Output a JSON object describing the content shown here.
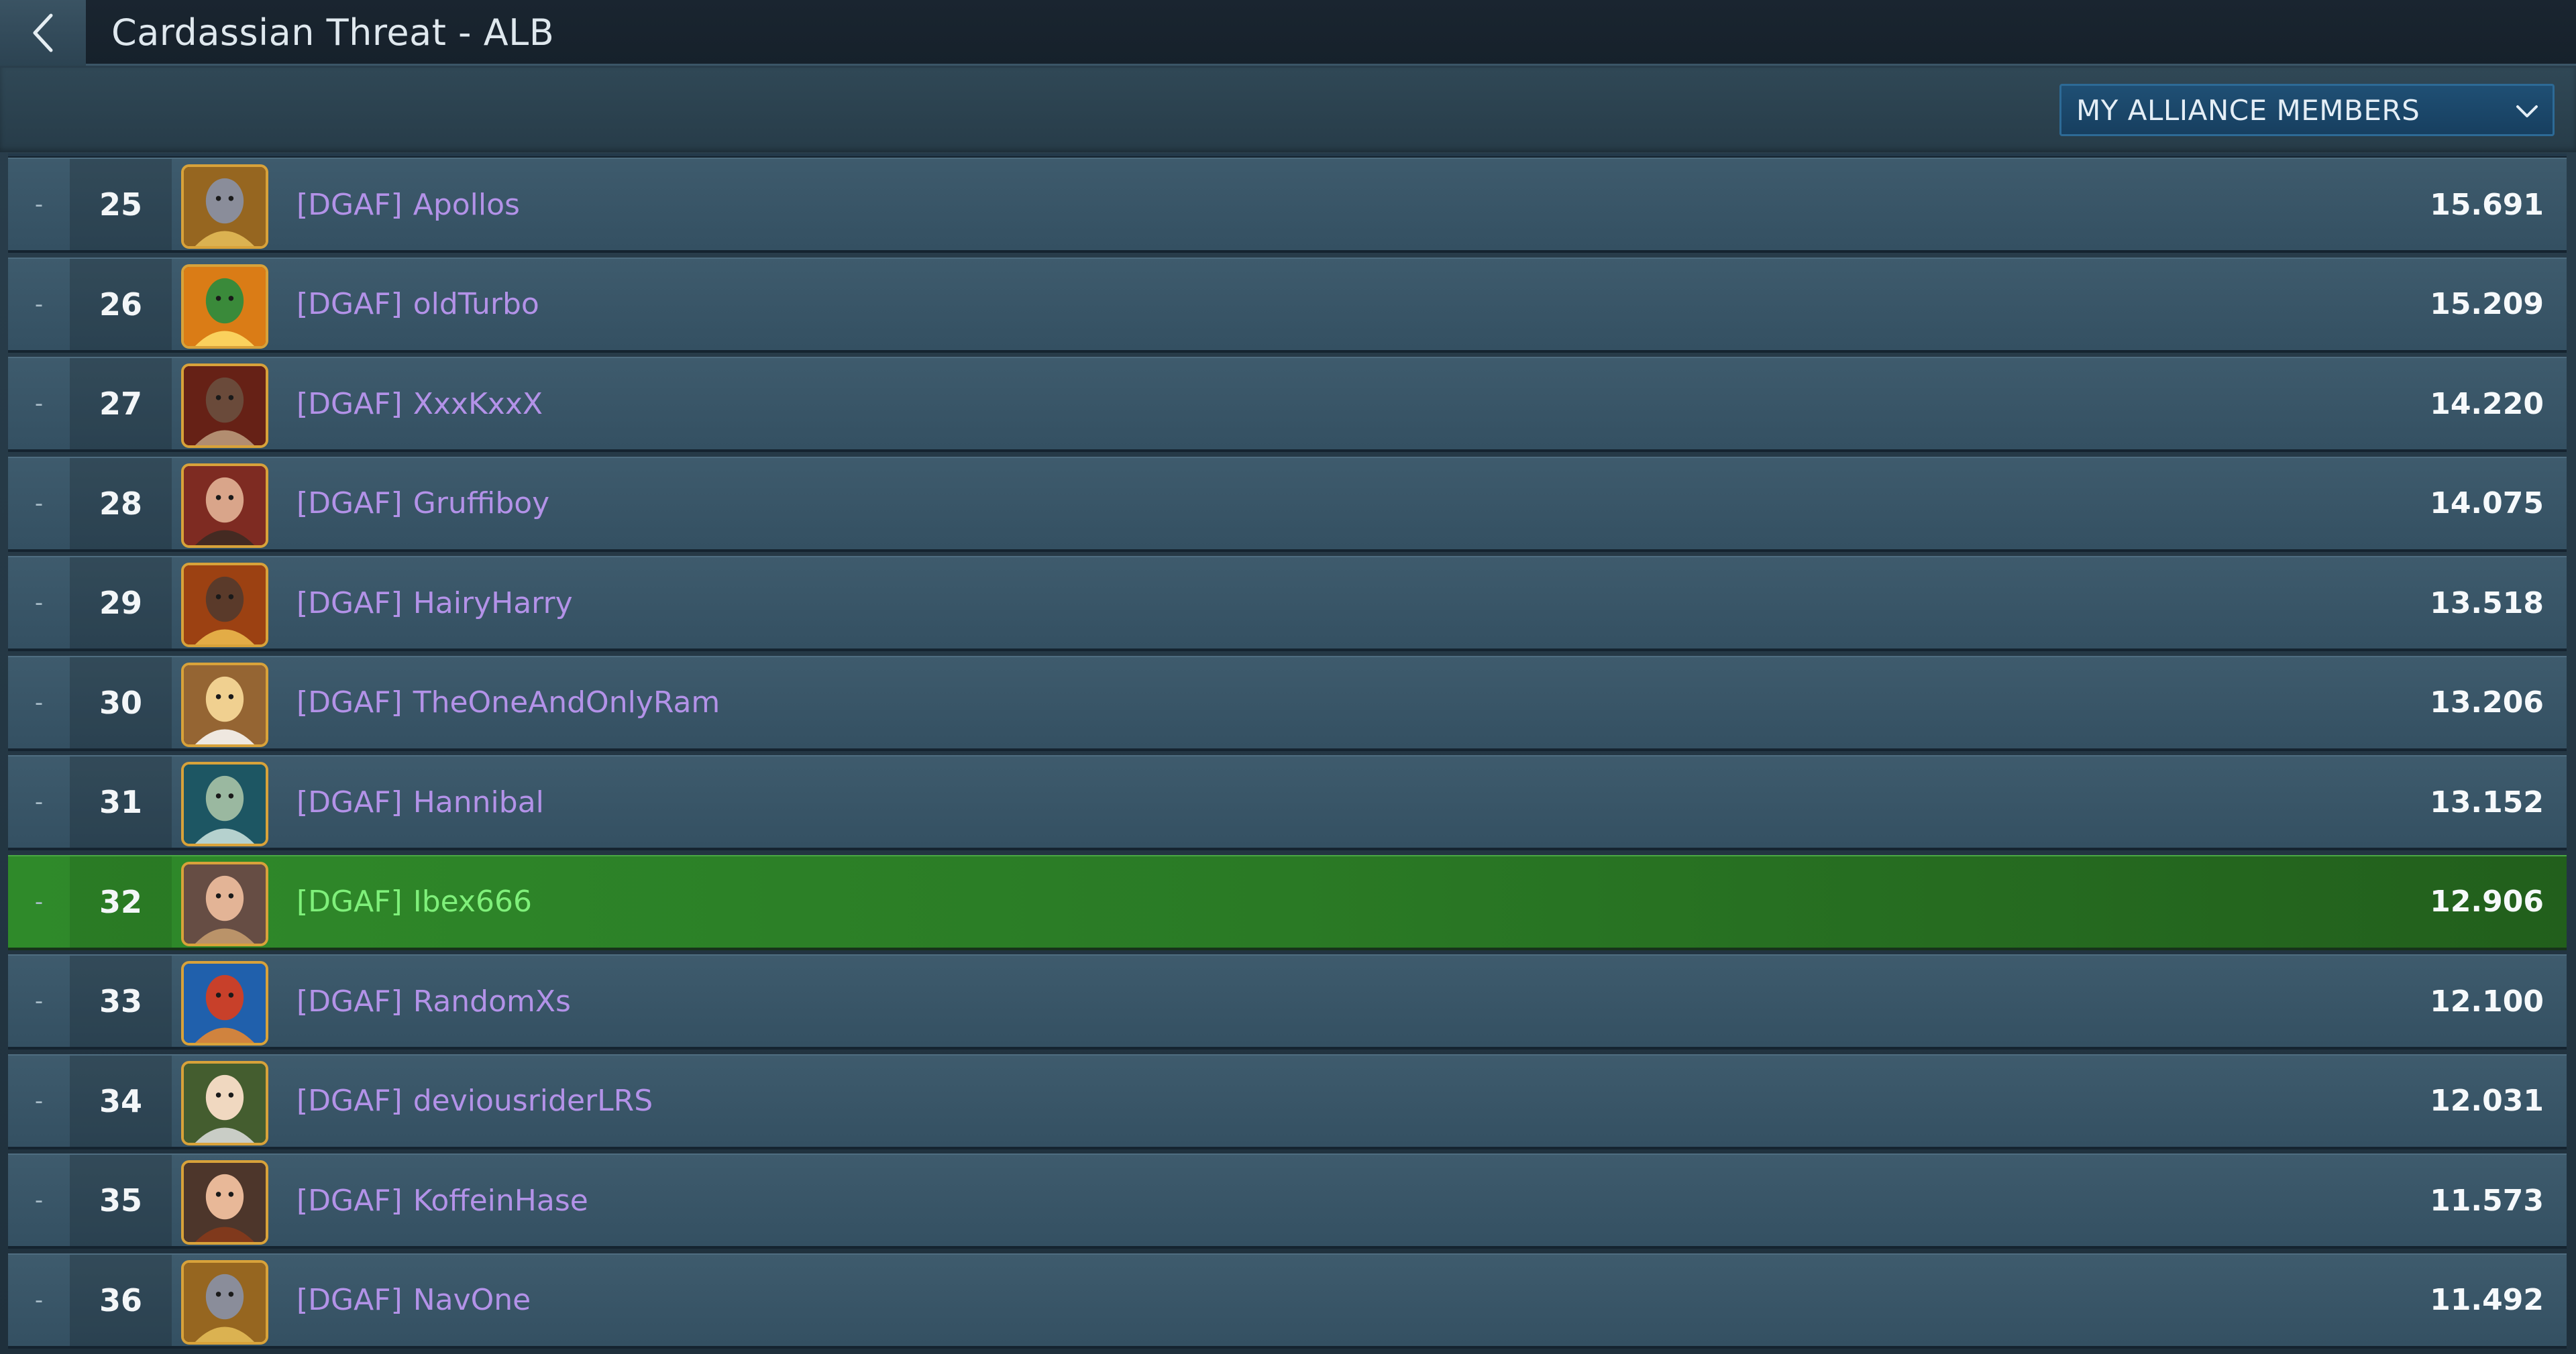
{
  "header": {
    "title": "Cardassian Threat - ALB",
    "back_icon": "chevron-left-icon"
  },
  "filter": {
    "selected": "MY ALLIANCE MEMBERS",
    "chevron_icon": "chevron-down-icon"
  },
  "colors": {
    "tag_purple": "#b392e8",
    "highlight_green": "#2f8a2a",
    "highlight_text": "#7ff07a"
  },
  "rows": [
    {
      "change": "-",
      "rank": "25",
      "tag": "[DGAF]",
      "player": "Apollos",
      "score": "15.691",
      "avatar": "crest-avatar-gold",
      "highlight": false
    },
    {
      "change": "-",
      "rank": "26",
      "tag": "[DGAF]",
      "player": "oldTurbo",
      "score": "15.209",
      "avatar": "emblem-avatar-orange",
      "highlight": false
    },
    {
      "change": "-",
      "rank": "27",
      "tag": "[DGAF]",
      "player": "XxxKxxX",
      "score": "14.220",
      "avatar": "klingon-portrait-avatar",
      "highlight": false
    },
    {
      "change": "-",
      "rank": "28",
      "tag": "[DGAF]",
      "player": "Gruffiboy",
      "score": "14.075",
      "avatar": "human-portrait-avatar",
      "highlight": false
    },
    {
      "change": "-",
      "rank": "29",
      "tag": "[DGAF]",
      "player": "HairyHarry",
      "score": "13.518",
      "avatar": "portrait-avatar-orange",
      "highlight": false
    },
    {
      "change": "-",
      "rank": "30",
      "tag": "[DGAF]",
      "player": "TheOneAndOnlyRam",
      "score": "13.206",
      "avatar": "ferengi-portrait-avatar",
      "highlight": false
    },
    {
      "change": "-",
      "rank": "31",
      "tag": "[DGAF]",
      "player": "Hannibal",
      "score": "13.152",
      "avatar": "android-portrait-avatar",
      "highlight": false
    },
    {
      "change": "-",
      "rank": "32",
      "tag": "[DGAF]",
      "player": "Ibex666",
      "score": "12.906",
      "avatar": "captain-facepalm-avatar",
      "highlight": true
    },
    {
      "change": "-",
      "rank": "33",
      "tag": "[DGAF]",
      "player": "RandomXs",
      "score": "12.100",
      "avatar": "bird-avatar-blue",
      "highlight": false
    },
    {
      "change": "-",
      "rank": "34",
      "tag": "[DGAF]",
      "player": "deviousriderLRS",
      "score": "12.031",
      "avatar": "cartoon-portrait-avatar",
      "highlight": false
    },
    {
      "change": "-",
      "rank": "35",
      "tag": "[DGAF]",
      "player": "KoffeinHase",
      "score": "11.573",
      "avatar": "woman-portrait-avatar",
      "highlight": false
    },
    {
      "change": "-",
      "rank": "36",
      "tag": "[DGAF]",
      "player": "NavOne",
      "score": "11.492",
      "avatar": "crest-avatar-gold",
      "highlight": false
    }
  ]
}
